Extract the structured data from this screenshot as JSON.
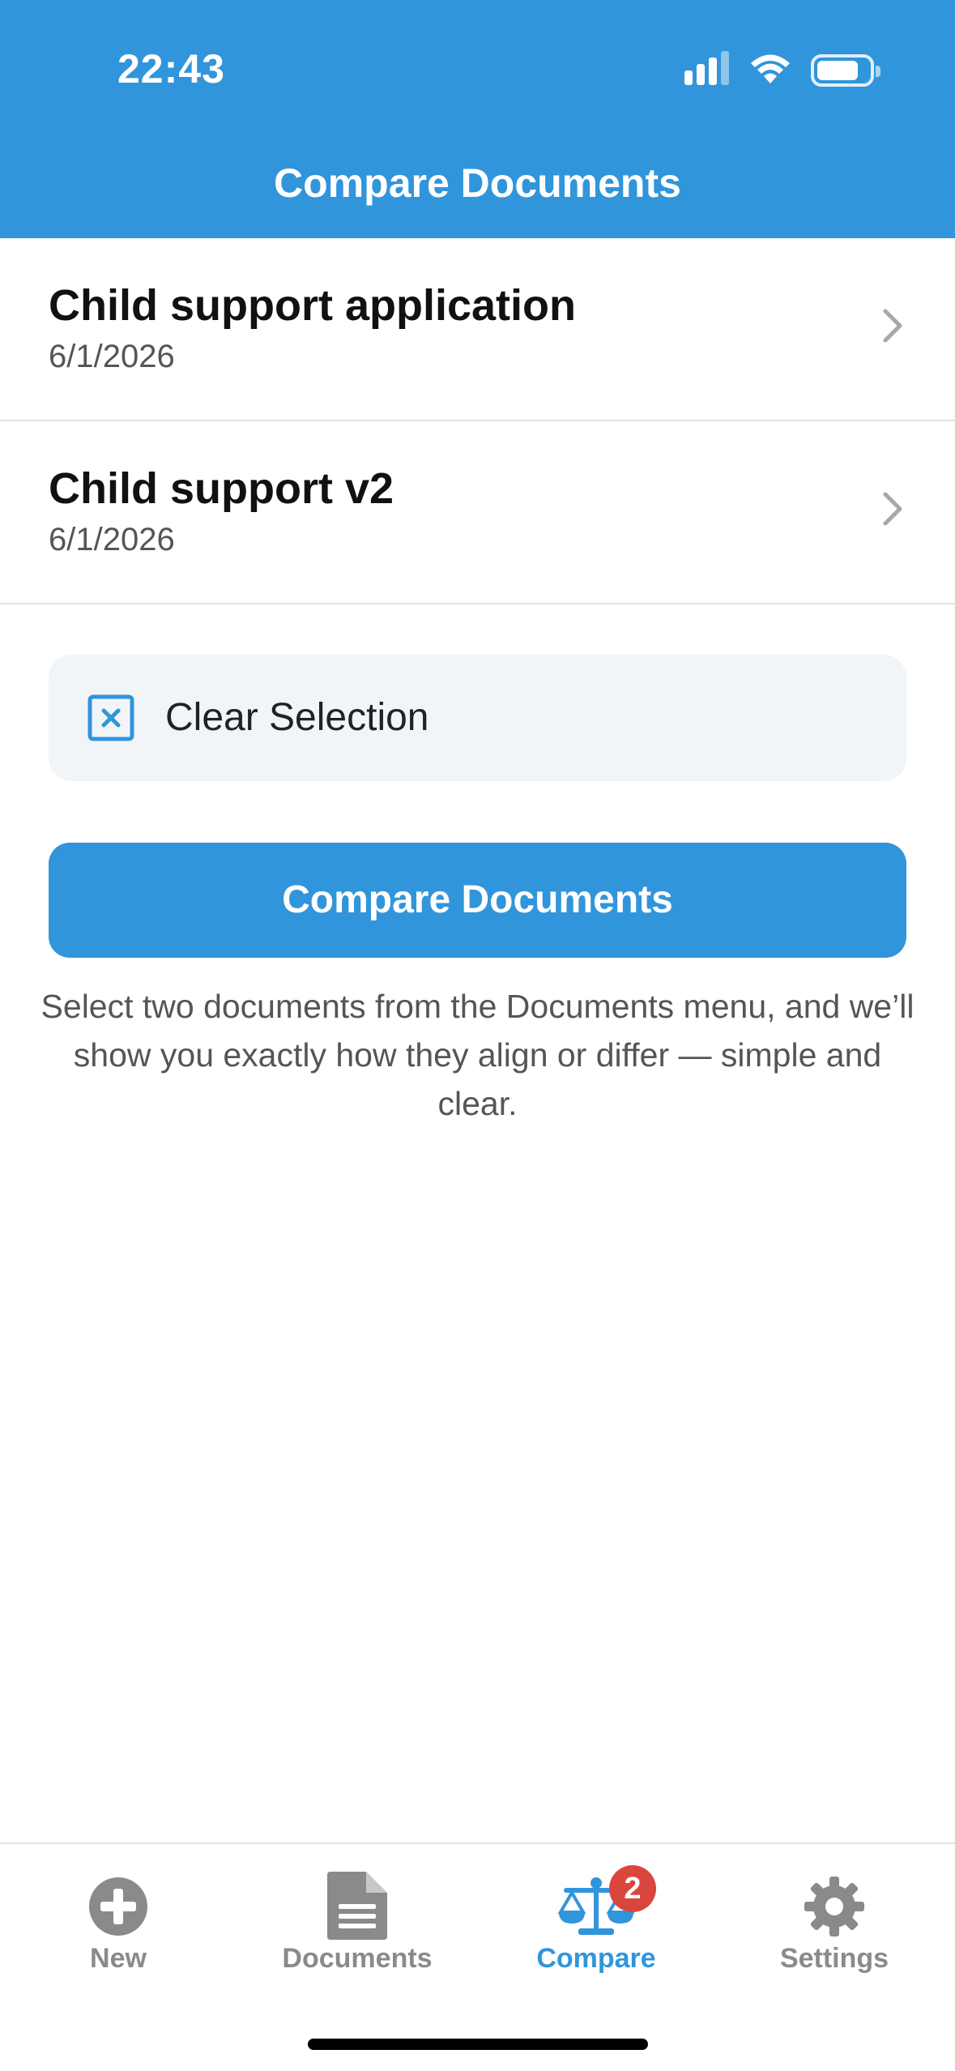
{
  "status_bar": {
    "time": "22:43"
  },
  "header": {
    "title": "Compare Documents"
  },
  "documents": [
    {
      "title": "Child support application",
      "date": "6/1/2026"
    },
    {
      "title": "Child support v2",
      "date": "6/1/2026"
    }
  ],
  "actions": {
    "clear_selection_label": "Clear Selection",
    "compare_label": "Compare Documents"
  },
  "help_text": "Select two documents from the Documents menu, and we’ll show you exactly how they align or differ — simple and clear.",
  "tabbar": {
    "tabs": [
      {
        "label": "New",
        "icon": "plus-circle-icon"
      },
      {
        "label": "Documents",
        "icon": "document-icon"
      },
      {
        "label": "Compare",
        "icon": "scale-icon",
        "badge": "2",
        "active": true
      },
      {
        "label": "Settings",
        "icon": "gear-icon"
      }
    ]
  },
  "colors": {
    "accent": "#3195DB",
    "badge": "#D9463E",
    "muted": "#8A8A8A"
  }
}
